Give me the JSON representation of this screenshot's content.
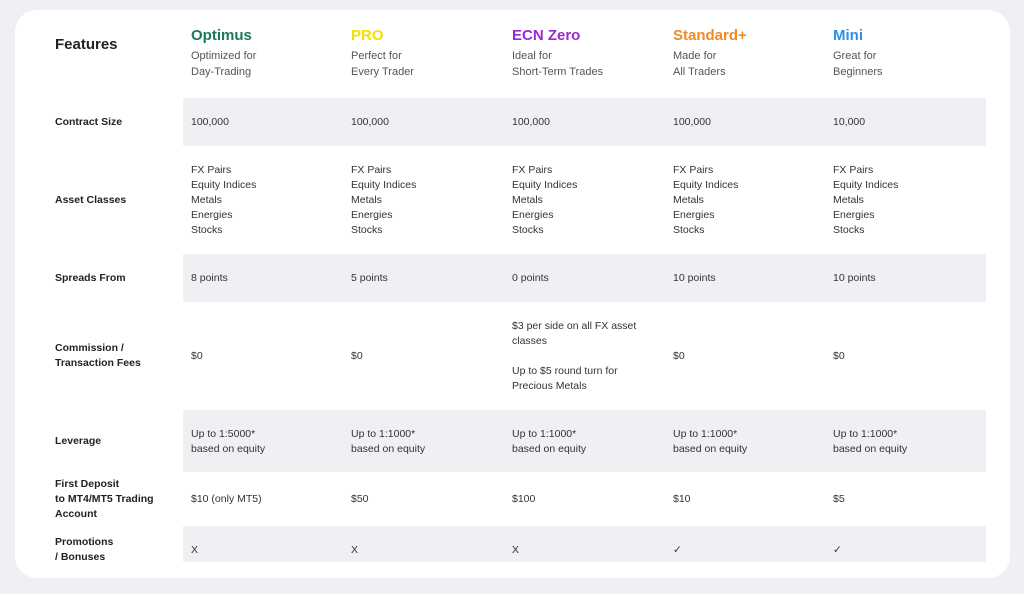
{
  "features_title": "Features",
  "plans": [
    {
      "name": "Optimus",
      "tagline": "Optimized for\nDay-Trading",
      "color": "#1a7a55"
    },
    {
      "name": "PRO",
      "tagline": "Perfect for\nEvery Trader",
      "color": "#f2e100"
    },
    {
      "name": "ECN Zero",
      "tagline": "Ideal for\nShort-Term Trades",
      "color": "#9b27d6"
    },
    {
      "name": "Standard+",
      "tagline": "Made for\nAll Traders",
      "color": "#f08a24"
    },
    {
      "name": "Mini",
      "tagline": "Great for\nBeginners",
      "color": "#2f8fe8"
    }
  ],
  "rows": [
    {
      "label": "Contract Size",
      "values": [
        "100,000",
        "100,000",
        "100,000",
        "100,000",
        "10,000"
      ]
    },
    {
      "label": "Asset Classes",
      "values": [
        "FX Pairs\nEquity Indices\nMetals\nEnergies\nStocks",
        "FX Pairs\nEquity Indices\nMetals\nEnergies\nStocks",
        "FX Pairs\nEquity Indices\nMetals\nEnergies\nStocks",
        "FX Pairs\nEquity Indices\nMetals\nEnergies\nStocks",
        "FX Pairs\nEquity Indices\nMetals\nEnergies\nStocks"
      ]
    },
    {
      "label": "Spreads From",
      "values": [
        "8 points",
        "5 points",
        "0 points",
        "10 points",
        "10 points"
      ]
    },
    {
      "label": "Commission /\nTransaction Fees",
      "values": [
        "$0",
        "$0",
        "$3 per side on all FX asset\nclasses\n\nUp to $5 round turn for\nPrecious Metals",
        "$0",
        "$0"
      ]
    },
    {
      "label": "Leverage",
      "values": [
        "Up to 1:5000*\nbased on equity",
        "Up to 1:1000*\nbased on equity",
        "Up to 1:1000*\nbased on equity",
        "Up to 1:1000*\nbased on equity",
        "Up to 1:1000*\nbased on equity"
      ]
    },
    {
      "label": "First Deposit\nto MT4/MT5 Trading\nAccount",
      "values": [
        "$10 (only MT5)",
        "$50",
        "$100",
        "$10",
        "$5"
      ]
    },
    {
      "label": "Promotions\n/ Bonuses",
      "values": [
        "X",
        "X",
        "X",
        "✓",
        "✓"
      ]
    }
  ]
}
